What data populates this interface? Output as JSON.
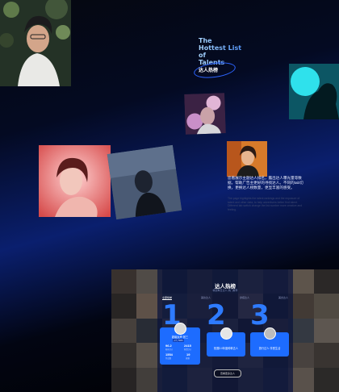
{
  "headline": {
    "line1": "The",
    "line2": "Hottest List",
    "line3": "of",
    "line4": "Talents",
    "sub": "达人热榜"
  },
  "description": {
    "cn": "您看展示主题达人排名，露出达人曝光量等数据，帮助广告主更好的寻找达人。不同的tab切换，更换达人榜数量，更显丰富的感受。",
    "en": "The page highlights the talent rankings and the exposure of talent and other data, to help advertisers better find talent. Different tab switch change the list number more creative and feeling."
  },
  "panel": {
    "title": "达人热榜",
    "subtitle": "精选每日达人·热门推荐",
    "tabs": [
      "全部榜单",
      "美妆达人",
      "穿搭达人",
      "美食达人"
    ],
    "rank_numbers": [
      "1",
      "2",
      "3"
    ],
    "cards": [
      {
        "name": "超级女声·张三",
        "badge": "人气 TOP1",
        "stats": [
          {
            "value": "96.2",
            "label": "粉丝(万)"
          },
          {
            "value": "2415",
            "label": "获赞(万)"
          },
          {
            "value": "1554",
            "label": "作品数"
          },
          {
            "value": "19",
            "label": "直播"
          }
        ]
      },
      {
        "name": "拓展3.0年度种草达人"
      },
      {
        "name": "旅行达人·享受生活"
      }
    ],
    "more_button": "查看更多达人"
  },
  "colors": {
    "accent": "#2e7bff",
    "card": "#1d6cff"
  }
}
